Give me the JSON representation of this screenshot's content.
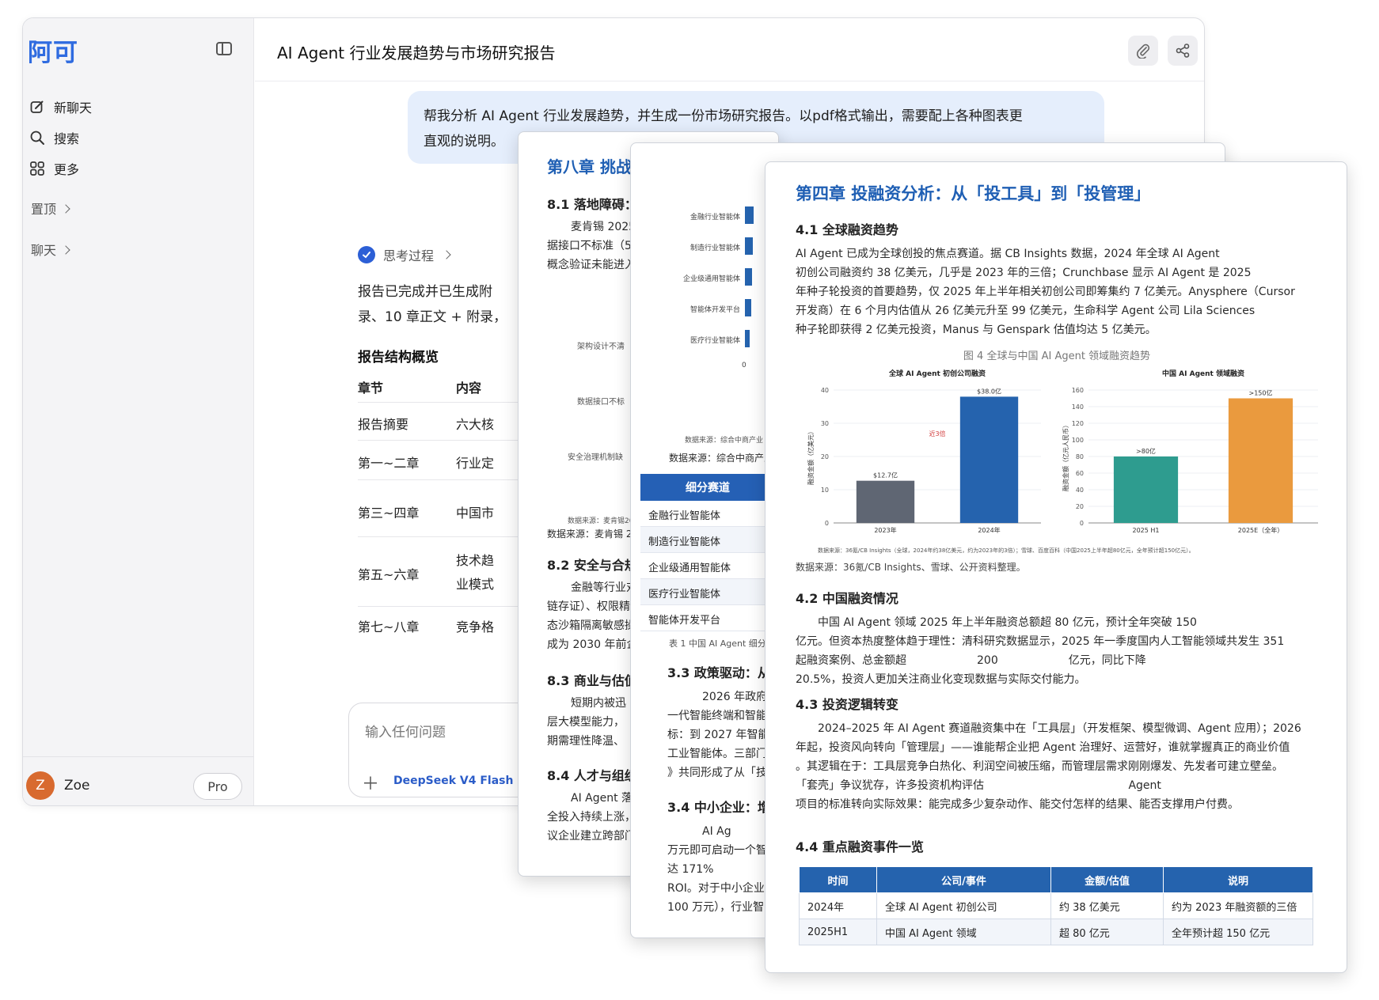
{
  "sidebar": {
    "logo": "阿可",
    "new_chat": "新聊天",
    "search": "搜索",
    "more": "更多",
    "pinned": "置顶",
    "chats": "聊天",
    "user": {
      "initial": "Z",
      "name": "Zoe",
      "plan": "Pro"
    }
  },
  "chat": {
    "title": "AI Agent 行业发展趋势与市场研究报告",
    "user_message_line1": "帮我分析 AI Agent 行业发展趋势，并生成一份市场研究报告。以pdf格式输出，需要配上各种图表更",
    "user_message_line2": "直观的说明。",
    "thinking": "思考过程",
    "response_line1": "报告已完成并已生成附",
    "response_line2": "录、10 章正文 + 附录，",
    "overview_heading": "报告结构概览",
    "table": {
      "headers": [
        "章节",
        "内容"
      ],
      "rows": [
        [
          "报告摘要",
          "六大核"
        ],
        [
          "第一~二章",
          "行业定"
        ],
        [
          "第三~四章",
          "中国市"
        ],
        [
          "第五~六章",
          "技术趋",
          "业模式"
        ],
        [
          "第七~八章",
          "竞争格"
        ]
      ]
    },
    "input_placeholder": "输入任何问题",
    "model": "DeepSeek V4 Flash"
  },
  "page_a": {
    "chapter": "第八章 挑战",
    "s81": "8.1 落地障碍：",
    "s81_l1": "麦肯锡 2025",
    "s81_l2": "据接口不标准（5",
    "s81_l3": "概念验证未能进入",
    "chart_labels": [
      "架构设计不清",
      "数据接口不标",
      "安全治理机制缺"
    ],
    "src_small": "数据来源：麦肯锡20",
    "src": "数据来源：麦肯锡 20",
    "s82": "8.2 安全与合规",
    "s82_lines": [
      "金融等行业对",
      "链存证）、权限精",
      "态沙箱隔离敏感操",
      "成为 2030 年前企"
    ],
    "s83": "8.3 商业与估值",
    "s83_lines": [
      "短期内被迅",
      "层大模型能力，",
      "期需理性降温、"
    ],
    "s84": "8.4 人才与组织",
    "s84_lines": [
      "AI Agent 落",
      "全投入持续上涨，",
      "议企业建立跨部门"
    ]
  },
  "page_b": {
    "bar_labels": [
      "金融行业智能体",
      "制造行业智能体",
      "企业级通用智能体",
      "智能体开发平台",
      "医疗行业智能体"
    ],
    "axis_zero": "0",
    "src_small": "数据来源：综合中商产业",
    "src": "数据来源：综合中商产业",
    "seg_header": "细分赛道",
    "segments": [
      "金融行业智能体",
      "制造行业智能体",
      "企业级通用智能体",
      "医疗行业智能体",
      "智能体开发平台"
    ],
    "table_caption": "表 1 中国 AI Agent 细分",
    "s33": "3.3 政策驱动：从",
    "s33_lines": [
      "2026 年政府工",
      "一代智能终端和智能",
      "标：到 2027 年智能",
      "工业智能体。三部门",
      "》共同形成了从「技"
    ],
    "s34": "3.4 中小企业：增",
    "s34_lines": [
      "AI Ag",
      "万元即可启动一个智",
      "达 171%",
      "ROI。对于中小企业",
      "100 万元），行业智"
    ]
  },
  "page_c": {
    "chapter": "第四章 投融资分析：从「投工具」到「投管理」",
    "s41": "4.1 全球融资趋势",
    "s41_text": [
      "AI Agent 已成为全球创投的焦点赛道。据 CB Insights 数据，2024 年全球 AI Agent",
      "初创公司融资约 38 亿美元，几乎是 2023 年的三倍；Crunchbase 显示 AI Agent 是 2025",
      "年种子轮投资的首要趋势，仅 2025 年上半年相关初创公司即筹集约 7 亿美元。Anysphere（Cursor",
      "开发商）在 6 个月内估值从 26 亿美元升至 99 亿美元，生命科学 Agent 公司 Lila Sciences",
      "种子轮即获得 2 亿美元投资，Manus 与 Genspark 估值均达 5 亿美元。"
    ],
    "fig_caption": "图 4 全球与中国 AI Agent 领域融资趋势",
    "fig_note": "数据来源：36氪/CB Insights（全球，2024年约38亿美元，约为2023年的3倍）；雪球、百度百科（中国2025上半年超80亿元，全年预计超150亿元）。",
    "fig_source": "数据来源：36氪/CB Insights、雪球、公开资料整理。",
    "s42": "4.2 中国融资情况",
    "s42_text": [
      "中国 AI Agent 领域 2025 年上半年融资总额超 80 亿元，预计全年突破 150",
      "亿元。但资本热度整体趋于理性：清科研究数据显示，2025 年一季度国内人工智能领域共发生 351",
      "起融资案例、总金额超                    200                    亿元，同比下降",
      "20.5%，投资人更加关注商业化变现数据与实际交付能力。"
    ],
    "s43": "4.3 投资逻辑转变",
    "s43_text": [
      "2024–2025 年 AI Agent 赛道融资集中在「工具层」（开发框架、模型微调、Agent 应用）；2026",
      "年起，投资风向转向「管理层」——谁能帮企业把 Agent 治理好、运营好，谁就掌握真正的商业价值",
      "。其逻辑在于：工具层竞争白热化、利润空间被压缩，而管理层需求刚刚爆发、先发者可建立壁垒。",
      "「套壳」争议犹存，许多投资机构评估                                         Agent",
      "项目的标准转向实际效果：能完成多少复杂动作、能交付怎样的结果、能否支撑用户付费。"
    ],
    "s44": "4.4 重点融资事件一览",
    "table": {
      "headers": [
        "时间",
        "公司/事件",
        "金额/估值",
        "说明"
      ],
      "rows": [
        [
          "2024年",
          "全球 AI Agent 初创公司",
          "约 38 亿美元",
          "约为 2023 年融资额的三倍"
        ],
        [
          "2025H1",
          "中国 AI Agent 领域",
          "超 80 亿元",
          "全年预计超 150 亿元"
        ]
      ]
    }
  },
  "chart_data": [
    {
      "type": "bar",
      "title": "全球 AI Agent 初创公司融资",
      "ylabel": "融资金额（亿美元）",
      "categories": [
        "2023年",
        "2024年"
      ],
      "values": [
        12.7,
        38.0
      ],
      "data_labels": [
        "$12.7亿",
        "$38.0亿"
      ],
      "annotation": "近3倍",
      "ylim": [
        0,
        40
      ],
      "yticks": [
        "0",
        "10",
        "20",
        "30",
        "40"
      ],
      "colors": [
        "#5f6673",
        "#2563ae"
      ]
    },
    {
      "type": "bar",
      "title": "中国 AI Agent 领域融资",
      "ylabel": "融资金额（亿元人民币）",
      "categories": [
        "2025 H1",
        "2025E（全年）"
      ],
      "values": [
        80,
        150
      ],
      "data_labels": [
        ">80亿",
        ">150亿"
      ],
      "ylim": [
        0,
        160
      ],
      "yticks": [
        "0",
        "20",
        "40",
        "60",
        "80",
        "100",
        "120",
        "140",
        "160"
      ],
      "colors": [
        "#2e9c8f",
        "#ea9a3e"
      ]
    }
  ],
  "page_b_bars": {
    "values": [
      9,
      8,
      7.5,
      6.5,
      5
    ]
  },
  "colors": {
    "accent": "#2f6be0",
    "doc_blue": "#1f5fb4",
    "header_blue": "#2563ae",
    "avatar": "#d86a2f"
  }
}
